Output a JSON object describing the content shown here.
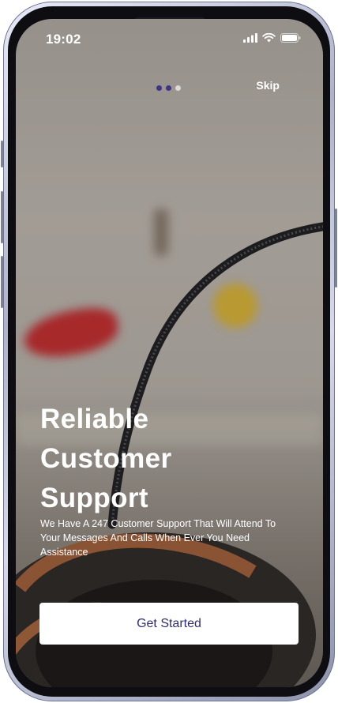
{
  "status_bar": {
    "time": "19:02"
  },
  "onboarding": {
    "skip_label": "Skip",
    "pager": {
      "total": 3,
      "active_index": 1,
      "colors": {
        "active": "#3a3783",
        "inactive": "#d9d9d9"
      }
    },
    "title_lines": [
      "Reliable",
      "Customer",
      "Support"
    ],
    "description": "We Have A 247 Customer Support That Will Attend To Your Messages And Calls When Ever You Need Assistance",
    "cta_label": "Get Started"
  },
  "colors": {
    "accent": "#2f2d72",
    "button_bg": "#ffffff",
    "text_on_image": "#ffffff"
  },
  "icons": [
    "signal-icon",
    "wifi-icon",
    "battery-icon"
  ]
}
